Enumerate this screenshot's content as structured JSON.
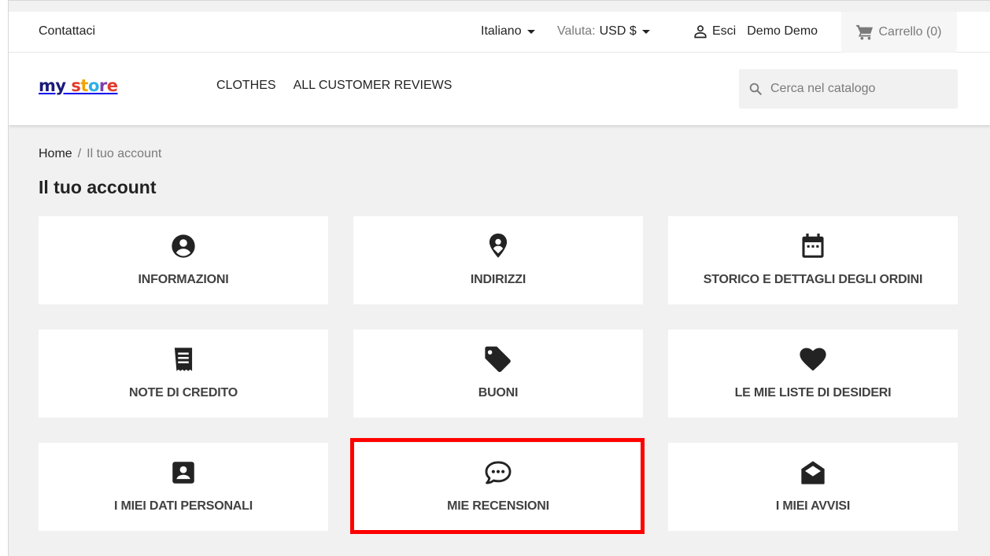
{
  "topbar": {
    "contact": "Contattaci",
    "language": "Italiano",
    "currency_label": "Valuta:",
    "currency_value": "USD $",
    "signout": "Esci",
    "user_name": "Demo Demo",
    "cart": "Carrello (0)"
  },
  "header": {
    "logo": {
      "part1": "my",
      "part2": "store"
    },
    "nav": [
      "CLOTHES",
      "ALL CUSTOMER REVIEWS"
    ],
    "search_placeholder": "Cerca nel catalogo"
  },
  "breadcrumb": {
    "home": "Home",
    "separator": "/",
    "current": "Il tuo account"
  },
  "page_title": "Il tuo account",
  "tiles": [
    {
      "label": "INFORMAZIONI",
      "icon": "account-circle-icon"
    },
    {
      "label": "INDIRIZZI",
      "icon": "location-pin-icon"
    },
    {
      "label": "STORICO E DETTAGLI DEGLI ORDINI",
      "icon": "calendar-icon"
    },
    {
      "label": "NOTE DI CREDITO",
      "icon": "receipt-icon"
    },
    {
      "label": "BUONI",
      "icon": "tag-icon"
    },
    {
      "label": "LE MIE LISTE DI DESIDERI",
      "icon": "heart-icon"
    },
    {
      "label": "I MIEI DATI PERSONALI",
      "icon": "contact-card-icon"
    },
    {
      "label": "MIE RECENSIONI",
      "icon": "comment-dots-icon"
    },
    {
      "label": "I MIEI AVVISI",
      "icon": "envelope-open-icon"
    }
  ],
  "colors": {
    "highlight": "#ff0000",
    "logo_my": "#1a1a7a",
    "text": "#232323",
    "muted": "#7a7a7a"
  }
}
